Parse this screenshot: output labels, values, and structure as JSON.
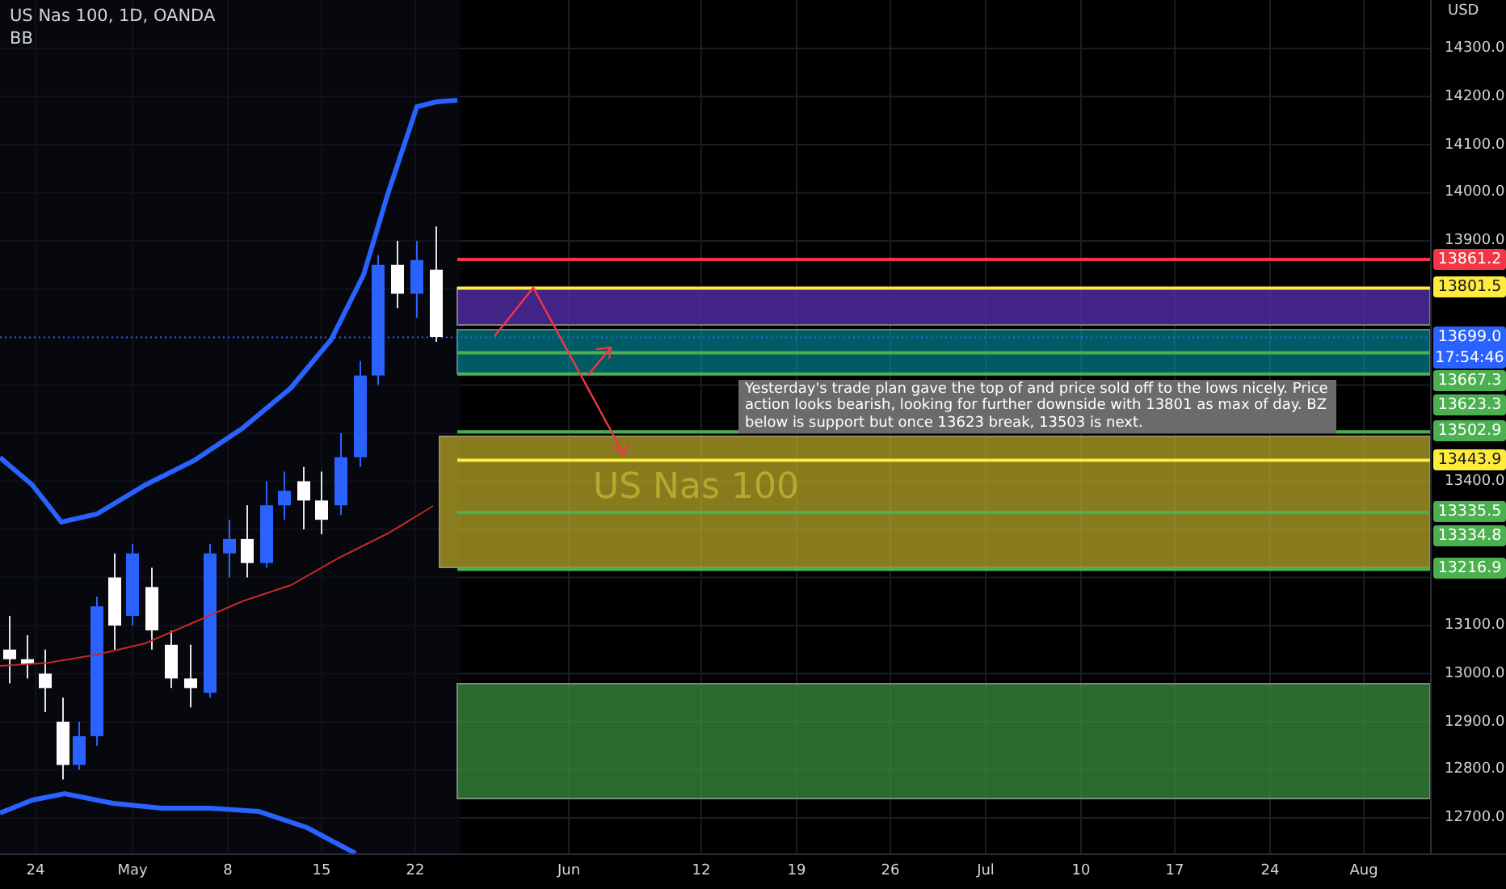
{
  "legend": {
    "title": "US Nas 100, 1D, OANDA",
    "indicator": "BB"
  },
  "watermark": {
    "description": "US Nas 100"
  },
  "price_axis": {
    "currency": "USD",
    "ticks": [
      "14300.0",
      "14200.0",
      "14100.0",
      "14000.0",
      "13900.0",
      "13400.0",
      "13100.0",
      "13000.0",
      "12900.0",
      "12800.0",
      "12700.0"
    ],
    "price_labels": [
      {
        "value": "13861.2",
        "color": "#f23645"
      },
      {
        "value": "13801.5",
        "color": "#ffeb3b"
      },
      {
        "value": "13699.0",
        "countdown": "17:54:46",
        "color": "#2962ff"
      },
      {
        "value": "13667.3",
        "color": "#4caf50"
      },
      {
        "value": "13623.3",
        "color": "#4caf50"
      },
      {
        "value": "13502.9",
        "color": "#4caf50"
      },
      {
        "value": "13443.9",
        "color": "#ffeb3b"
      },
      {
        "value": "13335.5",
        "color": "#4caf50"
      },
      {
        "value": "13334.8",
        "color": "#4caf50"
      },
      {
        "value": "13216.9",
        "color": "#4caf50"
      }
    ]
  },
  "time_axis": [
    "24",
    "May",
    "8",
    "15",
    "22",
    "Jun",
    "12",
    "19",
    "26",
    "Jul",
    "10",
    "17",
    "24",
    "Aug"
  ],
  "note": "Yesterday's trade plan gave the top of and price sold off to the lows nicely. Price action looks bearish, looking for further downside with 13801 as max of day. BZ below is support but once 13623 break, 13503 is next."
}
